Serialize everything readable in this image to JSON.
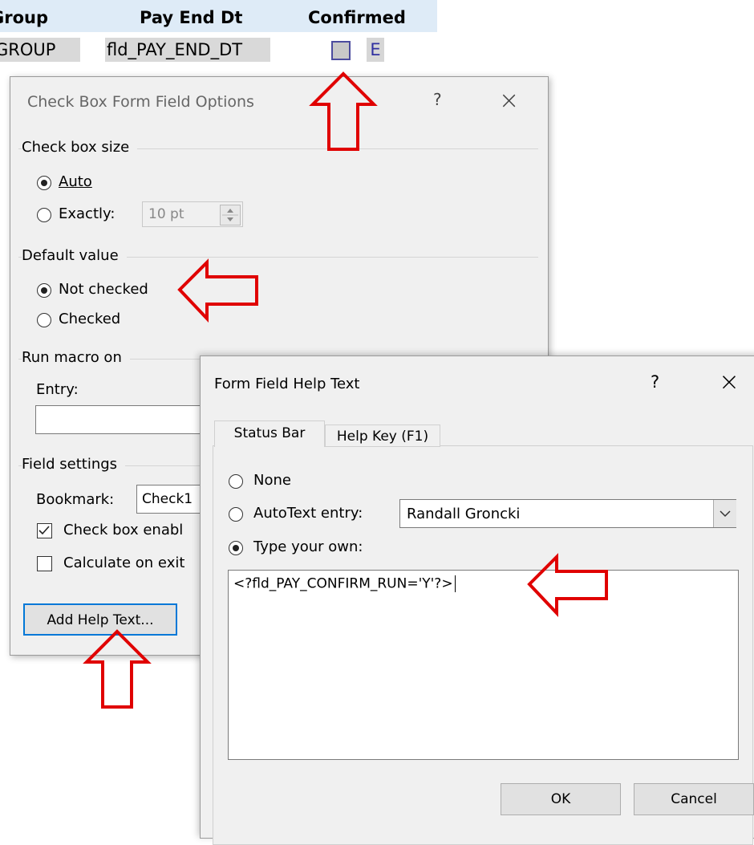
{
  "table": {
    "headers": {
      "group": "Group",
      "pay_end_dt": "Pay End Dt",
      "confirmed": "Confirmed"
    },
    "row": {
      "group_field": "GROUP",
      "pay_end_field": "fld_PAY_END_DT",
      "extra_field": "E"
    }
  },
  "checkbox_dialog": {
    "title": "Check Box Form Field Options",
    "help_btn": "?",
    "close_btn": "×",
    "size_section": "Check box size",
    "auto_label": "Auto",
    "exactly_label": "Exactly:",
    "exactly_value": "10 pt",
    "default_section": "Default value",
    "not_checked_label": "Not checked",
    "checked_label": "Checked",
    "macro_section": "Run macro on",
    "entry_label": "Entry:",
    "entry_value": "",
    "field_settings_section": "Field settings",
    "bookmark_label": "Bookmark:",
    "bookmark_value": "Check1",
    "enabled_label": "Check box enabl",
    "enabled_checked": true,
    "calc_label": "Calculate on exit",
    "calc_checked": false,
    "add_help_btn": "Add Help Text..."
  },
  "help_dialog": {
    "title": "Form Field Help Text",
    "help_btn": "?",
    "close_btn": "×",
    "tabs": [
      "Status Bar",
      "Help Key (F1)"
    ],
    "active_tab": "Status Bar",
    "none_label": "None",
    "autotext_label": "AutoText entry:",
    "autotext_value": "Randall Groncki",
    "type_own_label": "Type your own:",
    "selected_option": "Type your own:",
    "help_text": "<?fld_PAY_CONFIRM_RUN='Y'?>",
    "ok_btn": "OK",
    "cancel_btn": "Cancel"
  },
  "annotations": {
    "arrow_color": "#e00000"
  },
  "colors": {
    "table_header_bg": "#deebf7",
    "field_shading": "#d9d9d9",
    "dialog_bg": "#f0f0f0"
  }
}
